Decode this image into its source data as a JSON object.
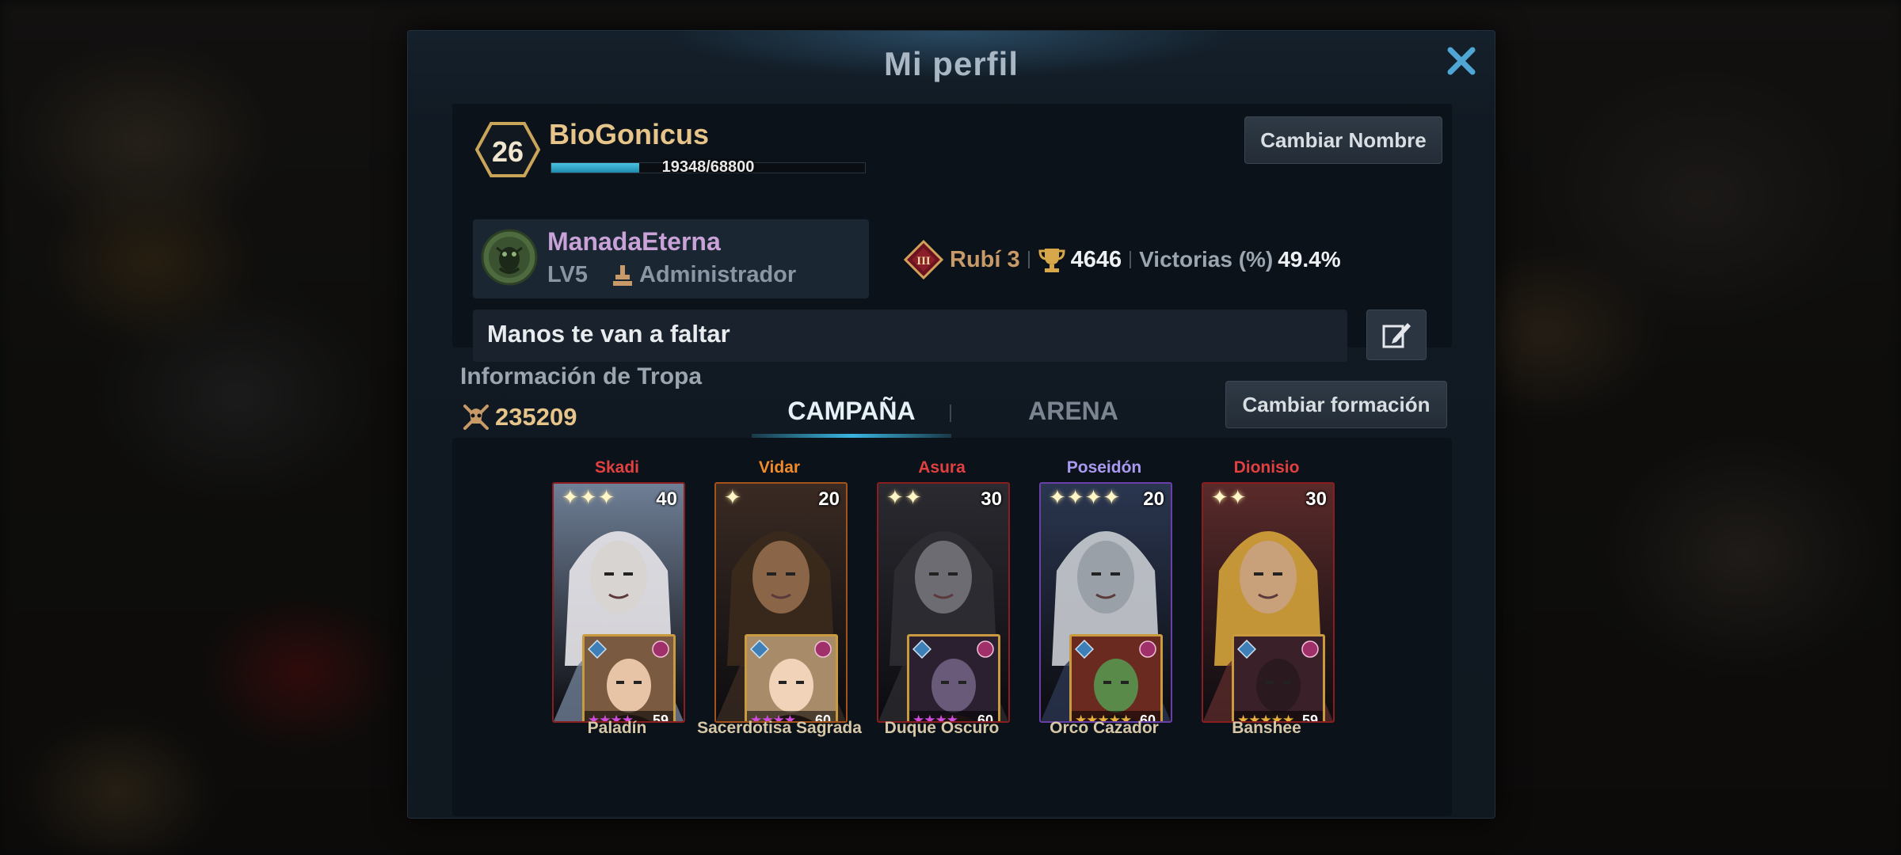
{
  "window": {
    "title": "Mi perfil"
  },
  "player": {
    "level": "26",
    "name": "BioGonicus",
    "xp_text": "19348/68800",
    "xp_fraction": 0.2812,
    "rename_label": "Cambiar Nombre"
  },
  "guild": {
    "name": "ManadaEterna",
    "level": "LV5",
    "role": "Administrador"
  },
  "stats": {
    "rank_numeral": "III",
    "rank_label": "Rubí 3",
    "trophies": "4646",
    "win_label": "Victorias (%)",
    "win_value": "49.4%"
  },
  "motto": "Manos te van a faltar",
  "troops": {
    "title": "Información de Tropa",
    "power": "235209",
    "tabs": [
      "CAMPAÑA",
      "ARENA"
    ],
    "active_tab": "CAMPAÑA",
    "formation_label": "Cambiar formación"
  },
  "heroes": [
    {
      "name": "Skadi",
      "name_color": "#e04040",
      "stars": "✦✦✦",
      "level": "40",
      "frame": "#8a1e1e",
      "pet": {
        "name": "Paladín",
        "stars": "★★★★",
        "star_color": "#d44be0",
        "level": "59"
      }
    },
    {
      "name": "Vidar",
      "name_color": "#f08a2a",
      "stars": "✦",
      "level": "20",
      "frame": "#a5521a",
      "pet": {
        "name": "Sacerdotisa Sagrada",
        "stars": "★★★★",
        "star_color": "#d44be0",
        "level": "60"
      }
    },
    {
      "name": "Asura",
      "name_color": "#e04040",
      "stars": "✦✦",
      "level": "30",
      "frame": "#8a1e1e",
      "pet": {
        "name": "Duque Oscuro",
        "stars": "★★★★",
        "star_color": "#d44be0",
        "level": "60"
      }
    },
    {
      "name": "Poseidón",
      "name_color": "#a99af0",
      "stars": "✦✦✦✦",
      "level": "20",
      "frame": "#6a3fa8",
      "pet": {
        "name": "Orco Cazador",
        "stars": "★★★★★",
        "star_color": "#e8b23c",
        "level": "60"
      }
    },
    {
      "name": "Dionisio",
      "name_color": "#e04040",
      "stars": "✦✦",
      "level": "30",
      "frame": "#8a1e1e",
      "pet": {
        "name": "Banshee",
        "stars": "★★★★★",
        "star_color": "#e8b23c",
        "level": "59"
      }
    }
  ],
  "colors": {
    "accent": "#39b5e0",
    "gold": "#e6c48a",
    "panel": "#101820"
  },
  "icons": {
    "close": "close-icon",
    "rank": "rank-badge-icon",
    "trophy": "trophy-icon",
    "edit": "edit-icon",
    "power": "power-icon",
    "admin": "admin-icon"
  }
}
